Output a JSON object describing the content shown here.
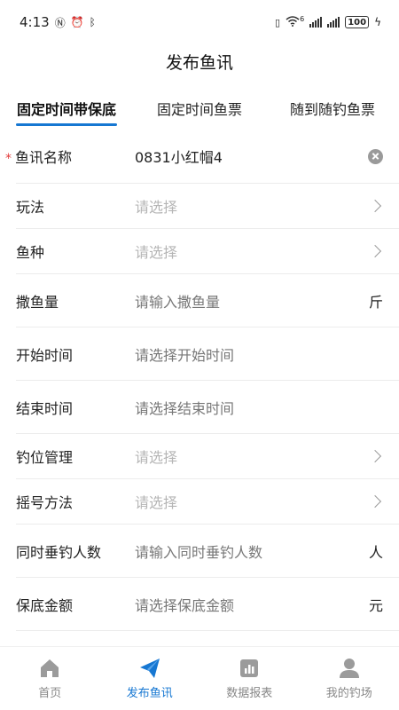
{
  "status": {
    "time": "4:13",
    "left_icons": [
      "nfc-icon",
      "alarm-icon",
      "bluetooth-icon"
    ],
    "right_icons": [
      "vibrate-icon",
      "wifi-icon",
      "signal-icon",
      "signal-icon"
    ],
    "wifi_badge": "6",
    "battery": "100"
  },
  "title": "发布鱼讯",
  "tabs": [
    {
      "label": "固定时间带保底",
      "active": true
    },
    {
      "label": "固定时间鱼票",
      "active": false
    },
    {
      "label": "随到随钓鱼票",
      "active": false
    }
  ],
  "form": {
    "rows": [
      {
        "label": "鱼讯名称",
        "required": true,
        "value": "0831小红帽4",
        "type": "text-filled",
        "trailing": "clear"
      },
      {
        "label": "玩法",
        "placeholder": "请选择",
        "type": "select",
        "trailing": "chevron"
      },
      {
        "label": "鱼种",
        "placeholder": "请选择",
        "type": "select",
        "trailing": "chevron"
      },
      {
        "label": "撒鱼量",
        "placeholder": "请输入撒鱼量",
        "type": "input",
        "unit": "斤"
      },
      {
        "label": "开始时间",
        "placeholder": "请选择开始时间",
        "type": "picker"
      },
      {
        "label": "结束时间",
        "placeholder": "请选择结束时间",
        "type": "picker"
      },
      {
        "label": "钓位管理",
        "placeholder": "请选择",
        "type": "select",
        "trailing": "chevron"
      },
      {
        "label": "摇号方法",
        "placeholder": "请选择",
        "type": "select",
        "trailing": "chevron"
      },
      {
        "label": "同时垂钓人数",
        "placeholder": "请输入同时垂钓人数",
        "type": "input",
        "unit": "人"
      },
      {
        "label": "保底金额",
        "placeholder": "请选择保底金额",
        "type": "picker",
        "unit": "元"
      }
    ]
  },
  "bottom_nav": [
    {
      "label": "首页",
      "icon": "home-icon",
      "active": false
    },
    {
      "label": "发布鱼讯",
      "icon": "send-icon",
      "active": true
    },
    {
      "label": "数据报表",
      "icon": "report-icon",
      "active": false
    },
    {
      "label": "我的钓场",
      "icon": "user-icon",
      "active": false
    }
  ],
  "colors": {
    "accent": "#1677d2",
    "required": "#e23b3b",
    "placeholder": "#b5b5b5"
  }
}
